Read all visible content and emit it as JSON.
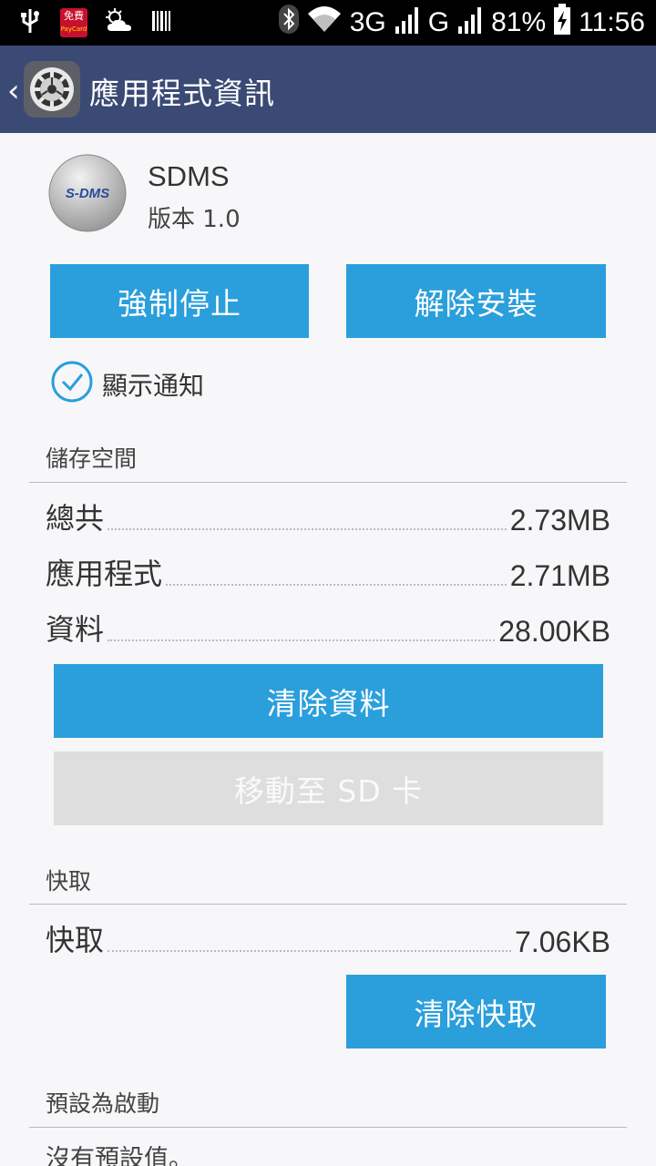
{
  "status_bar": {
    "pay_badge_top": "免費",
    "pay_badge_bottom": "PayCard",
    "network_3g": "3G",
    "network_g": "G",
    "battery": "81%",
    "time": "11:56",
    "icons": [
      "usb-icon",
      "mobile-payment-icon",
      "weather-icon",
      "barcode-icon",
      "bluetooth-icon",
      "wifi-icon",
      "signal-icon",
      "signal-icon-2",
      "battery-charging-icon"
    ]
  },
  "action_bar": {
    "title": "應用程式資訊"
  },
  "app": {
    "name": "SDMS",
    "version": "版本 1.0",
    "icon_text": "S-DMS"
  },
  "buttons": {
    "force_stop": "強制停止",
    "uninstall": "解除安裝",
    "clear_data": "清除資料",
    "move_to_sd": "移動至 SD 卡",
    "clear_cache": "清除快取"
  },
  "notifications": {
    "label": "顯示通知",
    "checked": true
  },
  "storage": {
    "header": "儲存空間",
    "rows": [
      {
        "label": "總共",
        "value": "2.73MB"
      },
      {
        "label": "應用程式",
        "value": "2.71MB"
      },
      {
        "label": "資料",
        "value": "28.00KB"
      }
    ]
  },
  "cache": {
    "header": "快取",
    "rows": [
      {
        "label": "快取",
        "value": "7.06KB"
      }
    ]
  },
  "launch_defaults": {
    "header": "預設為啟動",
    "text": "沒有預設值。"
  },
  "colors": {
    "action_bar": "#3a4a74",
    "button_blue": "#2a9fdc",
    "button_disabled": "#dedede",
    "background": "#f7f7f9"
  }
}
